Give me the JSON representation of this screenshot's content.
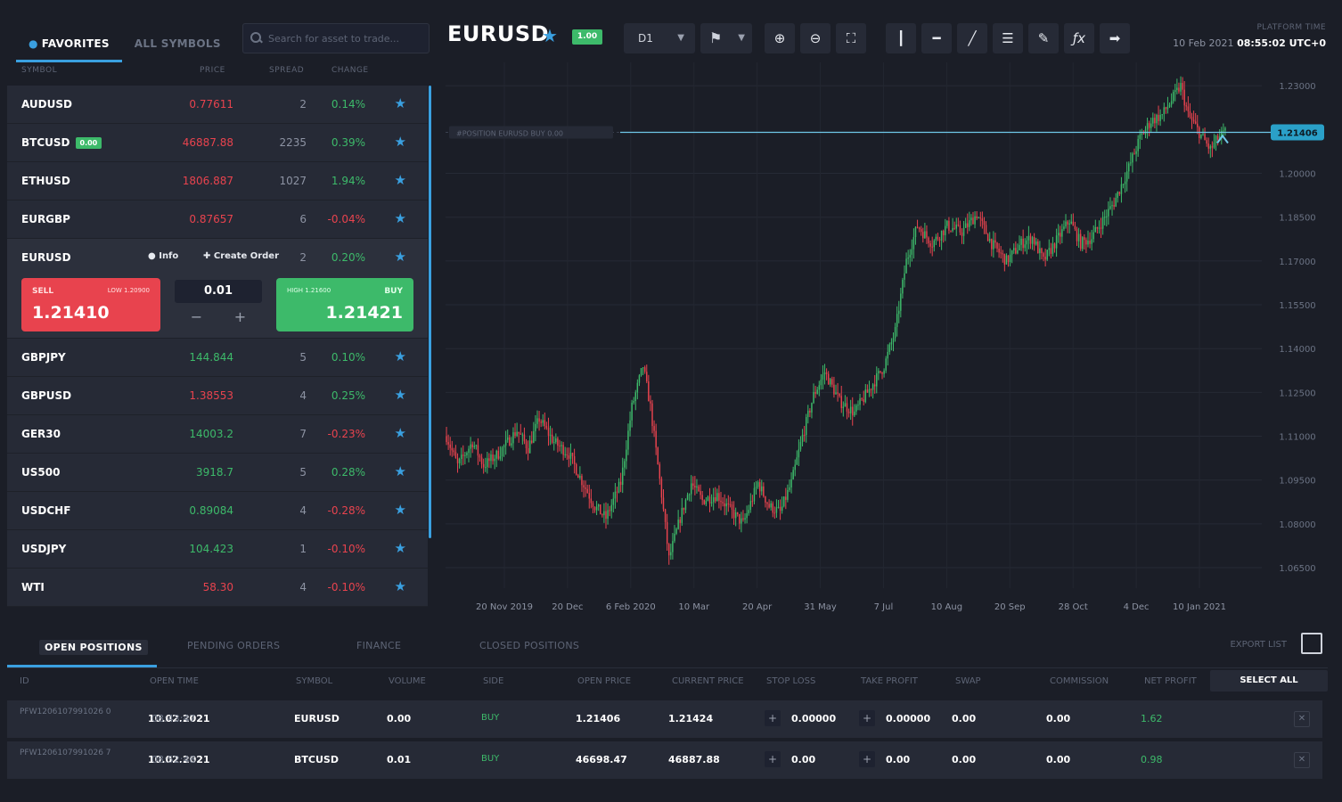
{
  "sidebar": {
    "tabs": [
      {
        "label": "FAVORITES",
        "active": true
      },
      {
        "label": "ALL SYMBOLS",
        "active": false
      }
    ],
    "search_placeholder": "Search for asset to trade...",
    "columns": [
      "SYMBOL",
      "PRICE",
      "SPREAD",
      "CHANGE"
    ],
    "rows_top": [
      {
        "symbol": "AUDUSD",
        "price": "0.77611",
        "price_dir": "down",
        "spread": "2",
        "change": "0.14%",
        "change_dir": "up"
      },
      {
        "symbol": "BTCUSD",
        "badge": "0.00",
        "price": "46887.88",
        "price_dir": "down",
        "spread": "2235",
        "change": "0.39%",
        "change_dir": "up"
      },
      {
        "symbol": "ETHUSD",
        "price": "1806.887",
        "price_dir": "down",
        "spread": "1027",
        "change": "1.94%",
        "change_dir": "up"
      },
      {
        "symbol": "EURGBP",
        "price": "0.87657",
        "price_dir": "down",
        "spread": "6",
        "change": "-0.04%",
        "change_dir": "down"
      }
    ],
    "expanded": {
      "symbol": "EURUSD",
      "info_label": "Info",
      "create_order_label": "Create Order",
      "spread": "2",
      "change": "0.20%",
      "sell_label": "SELL",
      "sell_small": "LOW 1.20900",
      "sell_price": "1.21410",
      "volume": "0.01",
      "buy_label": "BUY",
      "buy_small": "HIGH 1.21600",
      "buy_price": "1.21421"
    },
    "rows_bottom": [
      {
        "symbol": "GBPJPY",
        "price": "144.844",
        "price_dir": "up",
        "spread": "5",
        "change": "0.10%",
        "change_dir": "up"
      },
      {
        "symbol": "GBPUSD",
        "price": "1.38553",
        "price_dir": "down",
        "spread": "4",
        "change": "0.25%",
        "change_dir": "up"
      },
      {
        "symbol": "GER30",
        "price": "14003.2",
        "price_dir": "up",
        "spread": "7",
        "change": "-0.23%",
        "change_dir": "down"
      },
      {
        "symbol": "US500",
        "price": "3918.7",
        "price_dir": "up",
        "spread": "5",
        "change": "0.28%",
        "change_dir": "up"
      },
      {
        "symbol": "USDCHF",
        "price": "0.89084",
        "price_dir": "up",
        "spread": "4",
        "change": "-0.28%",
        "change_dir": "down"
      },
      {
        "symbol": "USDJPY",
        "price": "104.423",
        "price_dir": "up",
        "spread": "1",
        "change": "-0.10%",
        "change_dir": "down"
      },
      {
        "symbol": "WTI",
        "price": "58.30",
        "price_dir": "down",
        "spread": "4",
        "change": "-0.10%",
        "change_dir": "down"
      }
    ]
  },
  "toolbar": {
    "ticker": "EURUSD",
    "badge": "1.00",
    "timeframe": "D1",
    "tools": [
      "crosshair-icon",
      "horizontal-line-icon",
      "trend-line-icon",
      "channel-icon",
      "ruler-icon",
      "fx-indicator-icon",
      "snapshot-icon"
    ],
    "platform_time_label": "PLATFORM TIME",
    "platform_date": "10 Feb 2021",
    "platform_time": "08:55:02 UTC+0"
  },
  "chart_data": {
    "type": "candlestick",
    "symbol": "EURUSD",
    "x_ticks": [
      "20 Nov 2019",
      "20 Dec",
      "6 Feb 2020",
      "10 Mar",
      "20 Apr",
      "31 May",
      "7 Jul",
      "10 Aug",
      "20 Sep",
      "28 Oct",
      "4 Dec",
      "10 Jan 2021"
    ],
    "y_ticks": [
      "1.23000",
      "1.21406",
      "1.20000",
      "1.18500",
      "1.17000",
      "1.15500",
      "1.14000",
      "1.12500",
      "1.11000",
      "1.09500",
      "1.08000",
      "1.06500"
    ],
    "ylim": [
      1.058,
      1.238
    ],
    "current_price": 1.21406,
    "current_label": "1.21406",
    "position_line_label": "#POSITION EURUSD BUY 0.00",
    "path": [
      [
        0,
        1.11
      ],
      [
        6,
        1.1
      ],
      [
        14,
        1.108
      ],
      [
        20,
        1.1
      ],
      [
        28,
        1.104
      ],
      [
        38,
        1.112
      ],
      [
        44,
        1.106
      ],
      [
        50,
        1.116
      ],
      [
        58,
        1.108
      ],
      [
        66,
        1.104
      ],
      [
        72,
        1.096
      ],
      [
        80,
        1.086
      ],
      [
        86,
        1.082
      ],
      [
        94,
        1.094
      ],
      [
        100,
        1.12
      ],
      [
        106,
        1.134
      ],
      [
        110,
        1.12
      ],
      [
        116,
        1.09
      ],
      [
        120,
        1.068
      ],
      [
        126,
        1.082
      ],
      [
        132,
        1.094
      ],
      [
        138,
        1.088
      ],
      [
        146,
        1.09
      ],
      [
        154,
        1.084
      ],
      [
        160,
        1.08
      ],
      [
        168,
        1.094
      ],
      [
        174,
        1.086
      ],
      [
        180,
        1.084
      ],
      [
        186,
        1.094
      ],
      [
        192,
        1.11
      ],
      [
        198,
        1.124
      ],
      [
        204,
        1.132
      ],
      [
        212,
        1.122
      ],
      [
        220,
        1.118
      ],
      [
        228,
        1.126
      ],
      [
        236,
        1.134
      ],
      [
        242,
        1.146
      ],
      [
        248,
        1.17
      ],
      [
        254,
        1.182
      ],
      [
        262,
        1.176
      ],
      [
        270,
        1.182
      ],
      [
        278,
        1.18
      ],
      [
        286,
        1.186
      ],
      [
        294,
        1.176
      ],
      [
        302,
        1.17
      ],
      [
        310,
        1.176
      ],
      [
        316,
        1.178
      ],
      [
        322,
        1.17
      ],
      [
        330,
        1.178
      ],
      [
        336,
        1.184
      ],
      [
        342,
        1.176
      ],
      [
        348,
        1.178
      ],
      [
        354,
        1.184
      ],
      [
        360,
        1.19
      ],
      [
        368,
        1.202
      ],
      [
        374,
        1.212
      ],
      [
        380,
        1.218
      ],
      [
        386,
        1.22
      ],
      [
        392,
        1.226
      ],
      [
        396,
        1.23
      ],
      [
        400,
        1.22
      ],
      [
        406,
        1.214
      ],
      [
        412,
        1.208
      ],
      [
        416,
        1.212
      ],
      [
        420,
        1.214
      ]
    ]
  },
  "bottom": {
    "tabs": [
      {
        "label": "OPEN POSITIONS",
        "active": true
      },
      {
        "label": "PENDING ORDERS",
        "active": false
      },
      {
        "label": "FINANCE",
        "active": false
      },
      {
        "label": "CLOSED POSITIONS",
        "active": false
      }
    ],
    "export_label": "EXPORT LIST",
    "columns": [
      "ID",
      "OPEN TIME",
      "SYMBOL",
      "VOLUME",
      "SIDE",
      "OPEN PRICE",
      "CURRENT PRICE",
      "STOP LOSS",
      "TAKE PROFIT",
      "SWAP",
      "COMMISSION",
      "NET PROFIT"
    ],
    "select_all": "SELECT ALL",
    "positions": [
      {
        "id": "PFW1206107991026 0",
        "date": "10.02.2021",
        "time": "08:43:47",
        "symbol": "EURUSD",
        "volume": "0.00",
        "side": "BUY",
        "open_price": "1.21406",
        "current_price": "1.21424",
        "stop_loss": "0.00000",
        "take_profit": "0.00000",
        "swap": "0.00",
        "commission": "0.00",
        "net_profit": "1.62"
      },
      {
        "id": "PFW1206107991026 7",
        "date": "10.02.2021",
        "time": "08:52:48",
        "symbol": "BTCUSD",
        "volume": "0.01",
        "side": "BUY",
        "open_price": "46698.47",
        "current_price": "46887.88",
        "stop_loss": "0.00",
        "take_profit": "0.00",
        "swap": "0.00",
        "commission": "0.00",
        "net_profit": "0.98"
      }
    ]
  }
}
